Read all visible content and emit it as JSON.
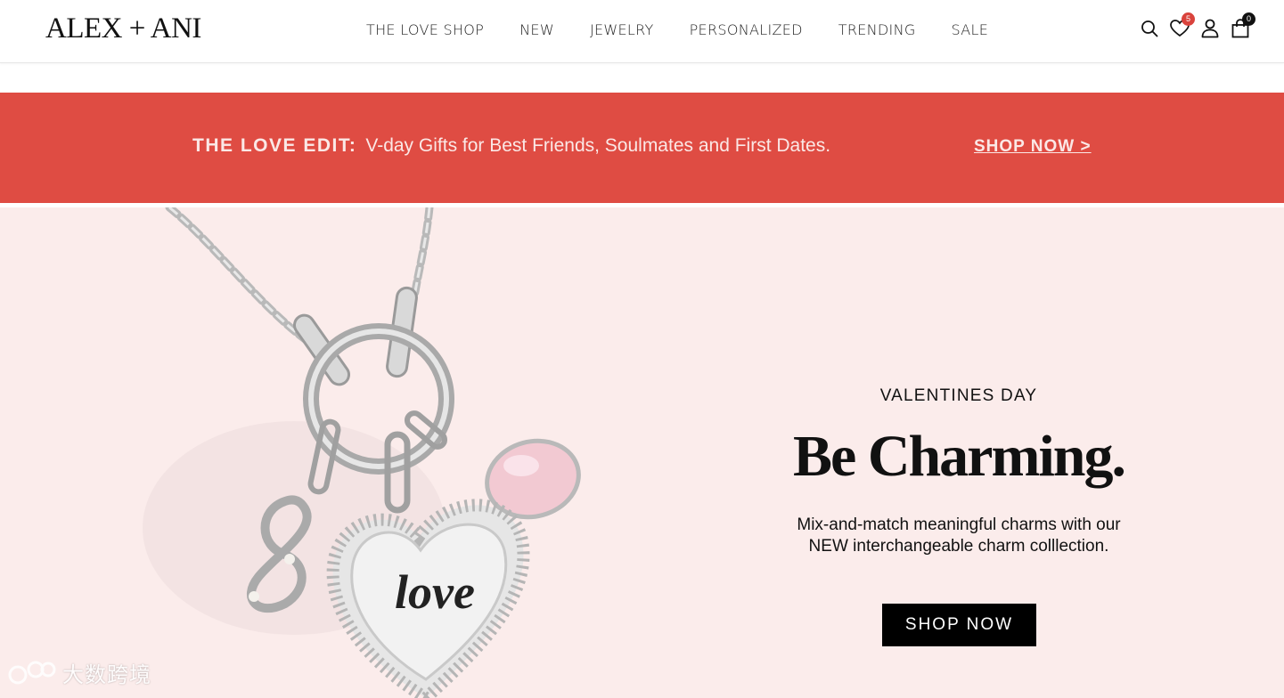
{
  "header": {
    "logo": "ALEX + ANI",
    "nav": [
      {
        "label": "THE LOVE SHOP"
      },
      {
        "label": "NEW"
      },
      {
        "label": "JEWELRY"
      },
      {
        "label": "PERSONALIZED"
      },
      {
        "label": "TRENDING"
      },
      {
        "label": "SALE"
      }
    ],
    "icons": {
      "search": "search-icon",
      "wishlist": "heart-icon",
      "wishlist_count": "5",
      "account": "user-icon",
      "cart": "shopping-bag-icon",
      "cart_count": "0"
    }
  },
  "promo": {
    "title": "THE LOVE EDIT:",
    "text": "V-day Gifts for Best Friends, Soulmates and First Dates.",
    "link": "SHOP NOW >",
    "bg_color": "#df4c43"
  },
  "hero": {
    "image": "silver-charm-necklace-with-love-heart-pendant",
    "eyebrow": "VALENTINES DAY",
    "headline": "Be Charming.",
    "subtext_line1": "Mix-and-match meaningful charms with our",
    "subtext_line2": "NEW interchangeable charm colllection.",
    "cta": "SHOP NOW",
    "bg_color": "#fbeceb",
    "heart_text": "love"
  },
  "watermark": {
    "text": "大数跨境"
  }
}
